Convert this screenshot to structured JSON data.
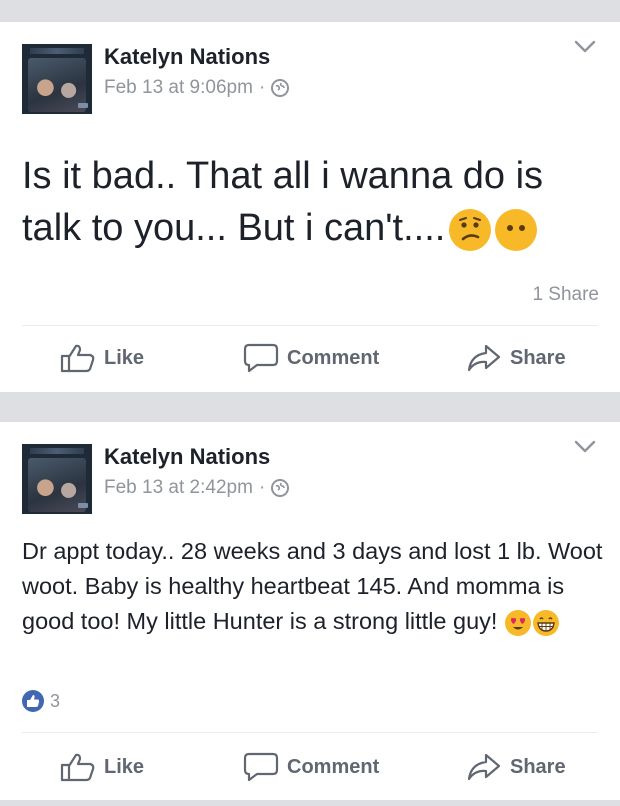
{
  "posts": [
    {
      "author": "Katelyn Nations",
      "timestamp": "Feb 13 at 9:06pm",
      "separator": "·",
      "privacy_icon": "globe-icon",
      "text": "Is it bad.. That all i wanna do is talk  to you... But i can't....",
      "emojis": [
        "confused-face",
        "blank-face"
      ],
      "shares": "1 Share",
      "reaction_count": "",
      "actions": {
        "like": "Like",
        "comment": "Comment",
        "share": "Share"
      }
    },
    {
      "author": "Katelyn Nations",
      "timestamp": "Feb 13 at 2:42pm",
      "separator": "·",
      "privacy_icon": "globe-icon",
      "text": "Dr appt today.. 28 weeks and 3 days and lost 1 lb. Woot woot. Baby is healthy heartbeat 145. And momma is good too! My little Hunter is a strong little guy!",
      "emojis": [
        "heart-eyes-face",
        "grinning-face"
      ],
      "shares": "",
      "reaction_count": "3",
      "actions": {
        "like": "Like",
        "comment": "Comment",
        "share": "Share"
      }
    }
  ],
  "colors": {
    "background": "#dddfe2",
    "card": "#ffffff",
    "text": "#1d2129",
    "meta": "#90949c",
    "action": "#606770",
    "like_blue": "#4267b2",
    "emoji_yellow": "#f7b928"
  }
}
